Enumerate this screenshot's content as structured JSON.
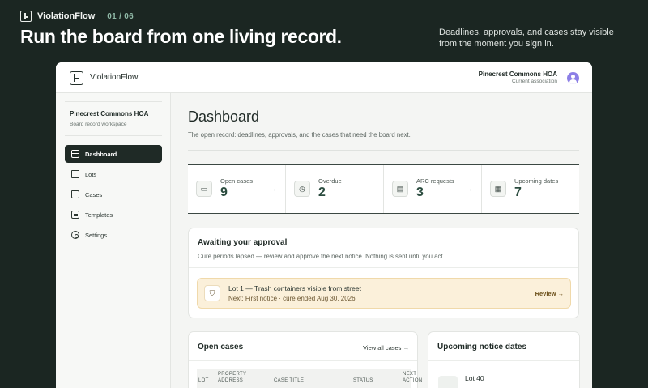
{
  "brand": {
    "name": "ViolationFlow",
    "step": "01 / 06"
  },
  "hero": {
    "title": "Run the board from one living record.",
    "subtitle": "Deadlines, approvals, and cases stay visible from the moment you sign in."
  },
  "app": {
    "name": "ViolationFlow",
    "association": "Pinecrest Commons HOA",
    "association_label": "Current association"
  },
  "sidebar": {
    "org_name": "Pinecrest Commons HOA",
    "org_sub": "Board record workspace",
    "items": [
      {
        "label": "Dashboard",
        "icon": "dashboard-icon",
        "active": true
      },
      {
        "label": "Lots",
        "icon": "home-icon",
        "active": false
      },
      {
        "label": "Cases",
        "icon": "folder-icon",
        "active": false
      },
      {
        "label": "Templates",
        "icon": "document-icon",
        "active": false
      },
      {
        "label": "Settings",
        "icon": "gear-icon",
        "active": false
      }
    ]
  },
  "main": {
    "title": "Dashboard",
    "subtitle": "The open record: deadlines, approvals, and the cases that need the board next."
  },
  "stats": [
    {
      "label": "Open cases",
      "value": "9",
      "icon": "folder-icon",
      "arrow": "→"
    },
    {
      "label": "Overdue",
      "value": "2",
      "icon": "clock-icon",
      "arrow": ""
    },
    {
      "label": "ARC requests",
      "value": "3",
      "icon": "document-icon",
      "arrow": "→"
    },
    {
      "label": "Upcoming dates",
      "value": "7",
      "icon": "calendar-icon",
      "arrow": ""
    }
  ],
  "approval": {
    "title": "Awaiting your approval",
    "subtitle": "Cure periods lapsed — review and approve the next notice. Nothing is sent until you act.",
    "item_title": "Lot 1 — Trash containers visible from street",
    "item_sub": "Next: First notice · cure ended Aug 30, 2026",
    "action": "Review →"
  },
  "open_cases": {
    "title": "Open cases",
    "link": "View all cases →",
    "columns": [
      "LOT",
      "PROPERTY ADDRESS",
      "CASE TITLE",
      "STATUS",
      "NEXT ACTION"
    ]
  },
  "upcoming": {
    "title": "Upcoming notice dates",
    "items": [
      "Lot 40"
    ]
  },
  "colors": {
    "background": "#1b2622",
    "accent": "#8fb8a6",
    "active_nav": "#1f2a26",
    "alert": "#fbf0da"
  }
}
